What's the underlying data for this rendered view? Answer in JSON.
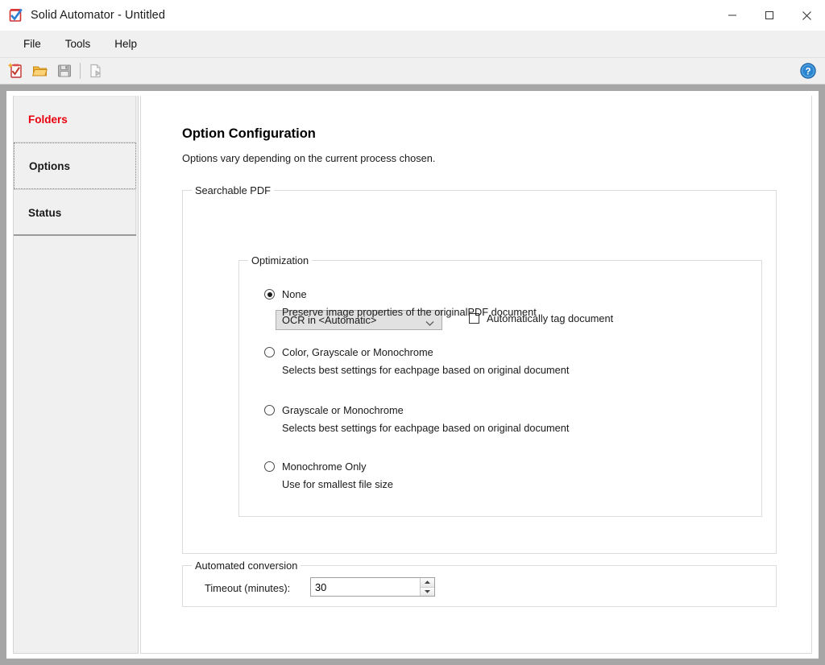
{
  "window": {
    "title": "Solid Automator - Untitled",
    "app_icon": "clipboard-check-icon",
    "controls": {
      "minimize": "minimize-icon",
      "maximize": "maximize-icon",
      "close": "close-icon"
    }
  },
  "menubar": {
    "items": [
      {
        "label": "File"
      },
      {
        "label": "Tools"
      },
      {
        "label": "Help"
      }
    ]
  },
  "toolbar": {
    "buttons": [
      {
        "name": "new-icon",
        "label": "New",
        "enabled": true
      },
      {
        "name": "open-folder-icon",
        "label": "Open",
        "enabled": true
      },
      {
        "name": "save-icon",
        "label": "Save",
        "enabled": false
      },
      {
        "name": "run-process-icon",
        "label": "Run",
        "enabled": false
      }
    ],
    "help": {
      "name": "help-icon",
      "label": "Help"
    }
  },
  "sidebar": {
    "tabs": [
      {
        "label": "Folders",
        "selected": false,
        "color": "#e8000d"
      },
      {
        "label": "Options",
        "selected": true,
        "color": "#1a1a1a"
      },
      {
        "label": "Status",
        "selected": false,
        "color": "#1a1a1a"
      }
    ]
  },
  "main": {
    "title": "Option Configuration",
    "subtitle": "Options vary depending on the current process chosen.",
    "searchable_pdf": {
      "legend": "Searchable PDF",
      "ocr_select": {
        "value": "OCR in <Automatic>",
        "options": [
          "OCR in <Automatic>"
        ]
      },
      "auto_tag": {
        "label": "Automatically tag document",
        "checked": false
      },
      "optimization": {
        "legend": "Optimization",
        "options": [
          {
            "label": "None",
            "description": "Preserve image properties of the originalPDF document",
            "selected": true
          },
          {
            "label": "Color, Grayscale or Monochrome",
            "description": "Selects best settings for eachpage based on original document",
            "selected": false
          },
          {
            "label": "Grayscale or Monochrome",
            "description": "Selects best settings for eachpage based on original document",
            "selected": false
          },
          {
            "label": "Monochrome Only",
            "description": "Use for smallest file size",
            "selected": false
          }
        ]
      }
    },
    "automated_conversion": {
      "legend": "Automated conversion",
      "timeout_label": "Timeout (minutes):",
      "timeout_value": "30"
    }
  }
}
